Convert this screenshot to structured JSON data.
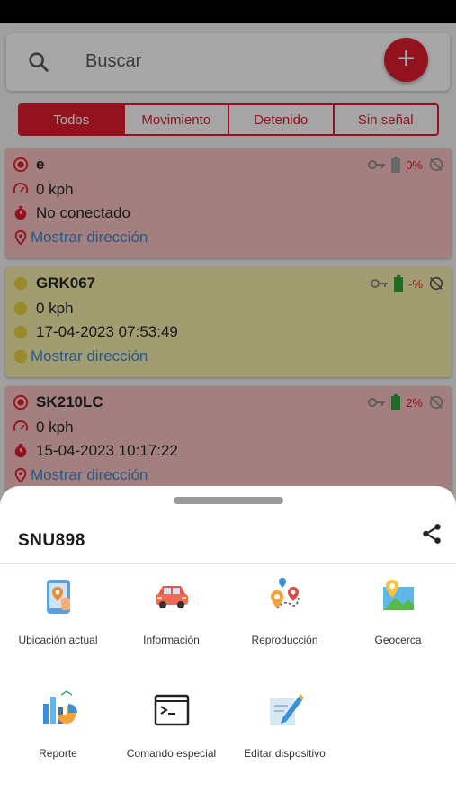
{
  "search": {
    "placeholder": "Buscar",
    "add_label": "+"
  },
  "filters": [
    "Todos",
    "Movimiento",
    "Detenido",
    "Sin señal"
  ],
  "devices": [
    {
      "name": "e",
      "speed": "0 kph",
      "time": "No conectado",
      "address_link": "Mostrar dirección",
      "battery": "0%",
      "status": "red"
    },
    {
      "name": "GRK067",
      "speed": "0 kph",
      "time": "17-04-2023 07:53:49",
      "address_link": "Mostrar dirección",
      "battery": "-%",
      "status": "yellow"
    },
    {
      "name": "SK210LC",
      "speed": "0 kph",
      "time": "15-04-2023 10:17:22",
      "address_link": "Mostrar dirección",
      "battery": "2%",
      "status": "red"
    }
  ],
  "sheet": {
    "device": "SNU898",
    "actions": [
      {
        "label": "Ubicación actual",
        "icon": "phone-location-icon"
      },
      {
        "label": "Información",
        "icon": "car-icon"
      },
      {
        "label": "Reproducción",
        "icon": "route-pins-icon"
      },
      {
        "label": "Geocerca",
        "icon": "map-icon"
      },
      {
        "label": "Reporte",
        "icon": "report-chart-icon"
      },
      {
        "label": "Comando especial",
        "icon": "terminal-icon"
      },
      {
        "label": "Editar dispositivo",
        "icon": "edit-note-icon"
      }
    ]
  },
  "colors": {
    "accent": "#d81b2c",
    "card_red": "#f1bcbc",
    "card_yellow": "#efe7a6",
    "link": "#3b82c4"
  }
}
